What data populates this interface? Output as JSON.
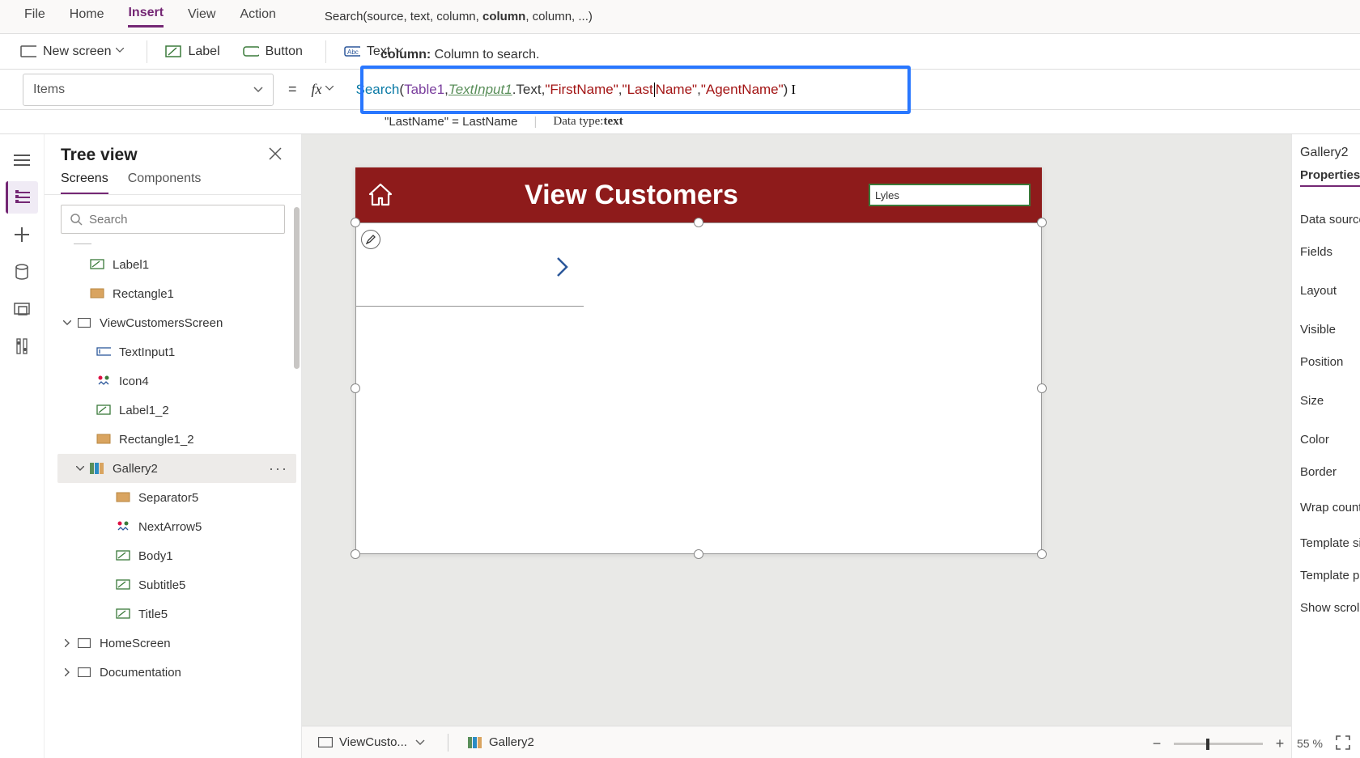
{
  "menu": {
    "file": "File",
    "home": "Home",
    "insert": "Insert",
    "view": "View",
    "action": "Action"
  },
  "formula_hint": {
    "prefix": "Search(source, text, column, ",
    "bold": "column",
    "suffix": ", column, ...)"
  },
  "hint2": {
    "bold": "column:",
    "text": " Column to search."
  },
  "ribbon": {
    "newscreen": "New screen",
    "label": "Label",
    "button": "Button",
    "text": "Text"
  },
  "property_selected": "Items",
  "formula": {
    "fn": "Search",
    "open": "(",
    "ds": "Table1",
    "c1": ", ",
    "ref": "TextInput1",
    "dot": ".Text",
    "c2": ", ",
    "s1": "\"FirstName\"",
    "c3": ", ",
    "s2a": "\"Last",
    "s2b": "Name\"",
    "c4": ", ",
    "s3": "\"AgentName\"",
    "close": ")"
  },
  "info_row": {
    "left": "\"LastName\"  =  LastName",
    "label": "Data type: ",
    "type": "text"
  },
  "tree": {
    "title": "Tree view",
    "tab_screens": "Screens",
    "tab_components": "Components",
    "search_placeholder": "Search",
    "items": {
      "label1": "Label1",
      "rect1": "Rectangle1",
      "viewscreen": "ViewCustomersScreen",
      "textinput1": "TextInput1",
      "icon4": "Icon4",
      "label12": "Label1_2",
      "rect12": "Rectangle1_2",
      "gallery2": "Gallery2",
      "sep5": "Separator5",
      "next5": "NextArrow5",
      "body1": "Body1",
      "sub5": "Subtitle5",
      "title5": "Title5",
      "homescreen": "HomeScreen",
      "doc": "Documentation"
    }
  },
  "canvas": {
    "screen_title": "View Customers",
    "search_value": "Lyles"
  },
  "breadcrumb": {
    "screen": "ViewCusto...",
    "control": "Gallery2"
  },
  "rightpanel": {
    "header": "Gallery2",
    "tab": "Properties",
    "rows": [
      "Data source",
      "Fields",
      "Layout",
      "Visible",
      "Position",
      "Size",
      "Color",
      "Border",
      "Wrap count",
      "Template size",
      "Template pa",
      "Show scroll"
    ]
  },
  "zoom": {
    "value": "55",
    "pct": "%"
  }
}
